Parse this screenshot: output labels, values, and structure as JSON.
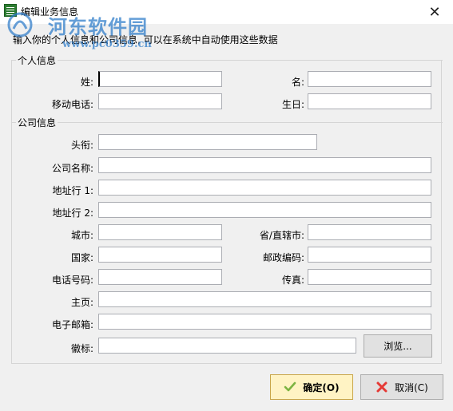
{
  "window": {
    "title": "编辑业务信息",
    "close_glyph": "✕"
  },
  "watermark": {
    "text": "河东软件园",
    "url": "www.pc0359.cn"
  },
  "instruction": "输入你的个人信息和公司信息, 可以在系统中自动使用这些数据",
  "personal": {
    "group_label": "个人信息",
    "last_name": {
      "label": "姓:",
      "value": ""
    },
    "first_name": {
      "label": "名:",
      "value": ""
    },
    "mobile": {
      "label": "移动电话:",
      "value": ""
    },
    "birthday": {
      "label": "生日:",
      "value": ""
    }
  },
  "company": {
    "group_label": "公司信息",
    "job_title": {
      "label": "头衔:",
      "value": ""
    },
    "company_name": {
      "label": "公司名称:",
      "value": ""
    },
    "address1": {
      "label": "地址行 1:",
      "value": ""
    },
    "address2": {
      "label": "地址行 2:",
      "value": ""
    },
    "city": {
      "label": "城市:",
      "value": ""
    },
    "province": {
      "label": "省/直辖市:",
      "value": ""
    },
    "country": {
      "label": "国家:",
      "value": ""
    },
    "postal_code": {
      "label": "邮政编码:",
      "value": ""
    },
    "phone": {
      "label": "电话号码:",
      "value": ""
    },
    "fax": {
      "label": "传真:",
      "value": ""
    },
    "homepage": {
      "label": "主页:",
      "value": ""
    },
    "email": {
      "label": "电子邮箱:",
      "value": ""
    },
    "logo": {
      "label": "徽标:",
      "value": ""
    },
    "browse_label": "浏览..."
  },
  "buttons": {
    "ok_label": "确定(O)",
    "cancel_label": "取消(C)"
  },
  "icons": {
    "app": "spreadsheet-icon",
    "ok": "checkmark-icon",
    "cancel": "red-x-icon"
  },
  "colors": {
    "ok_button_bg": "#fff3c4",
    "ok_check": "#7cb342",
    "cancel_x": "#e53935",
    "watermark": "#2878c8"
  }
}
